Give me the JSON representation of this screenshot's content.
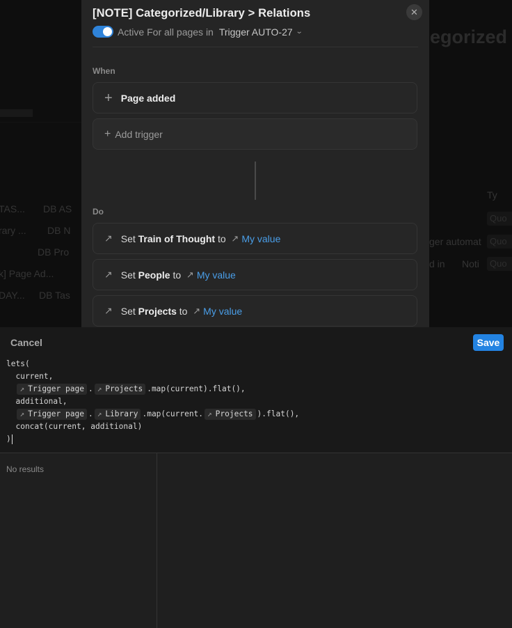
{
  "background": {
    "fragments": [
      "TAS...",
      "DB AS",
      "rary ...",
      "DB N",
      "DB Pro",
      "k] Page Ad...",
      "DAY...",
      "DB Tas",
      "egorized",
      "Ty",
      "ger automat",
      "d in",
      "Noti",
      "Quo",
      "Quo",
      "Quo"
    ]
  },
  "panel": {
    "title": "[NOTE] Categorized/Library > Relations",
    "status_active": "Active",
    "status_scope": "For all pages in",
    "trigger_db": "Trigger AUTO-27",
    "when_label": "When",
    "trigger_card": "Page added",
    "add_trigger": "Add trigger",
    "do_label": "Do",
    "actions": [
      {
        "prefix": "Set",
        "property": "Train of Thought",
        "to": "to",
        "value": "My value"
      },
      {
        "prefix": "Set",
        "property": "People",
        "to": "to",
        "value": "My value"
      },
      {
        "prefix": "Set",
        "property": "Projects",
        "to": "to",
        "value": "My value"
      }
    ]
  },
  "editor": {
    "cancel_label": "Cancel",
    "save_label": "Save",
    "code": {
      "l1": "lets(",
      "l2": "  current,",
      "l3_chip1": "Trigger page",
      "l3_dot": ".",
      "l3_chip2": "Projects",
      "l3_tail": ".map(current).flat(),",
      "l4": "  additional,",
      "l5_chip1": "Trigger page",
      "l5_dot": ".",
      "l5_chip2": "Library",
      "l5_mid": ".map(current.",
      "l5_chip3": "Projects",
      "l5_tail": ").flat(),",
      "l6": "  concat(current, additional)",
      "l7": ")"
    },
    "no_results": "No results"
  },
  "colors": {
    "accent": "#2383e2",
    "link": "#4a9ee8",
    "toggle_on": "#2f83d9"
  }
}
